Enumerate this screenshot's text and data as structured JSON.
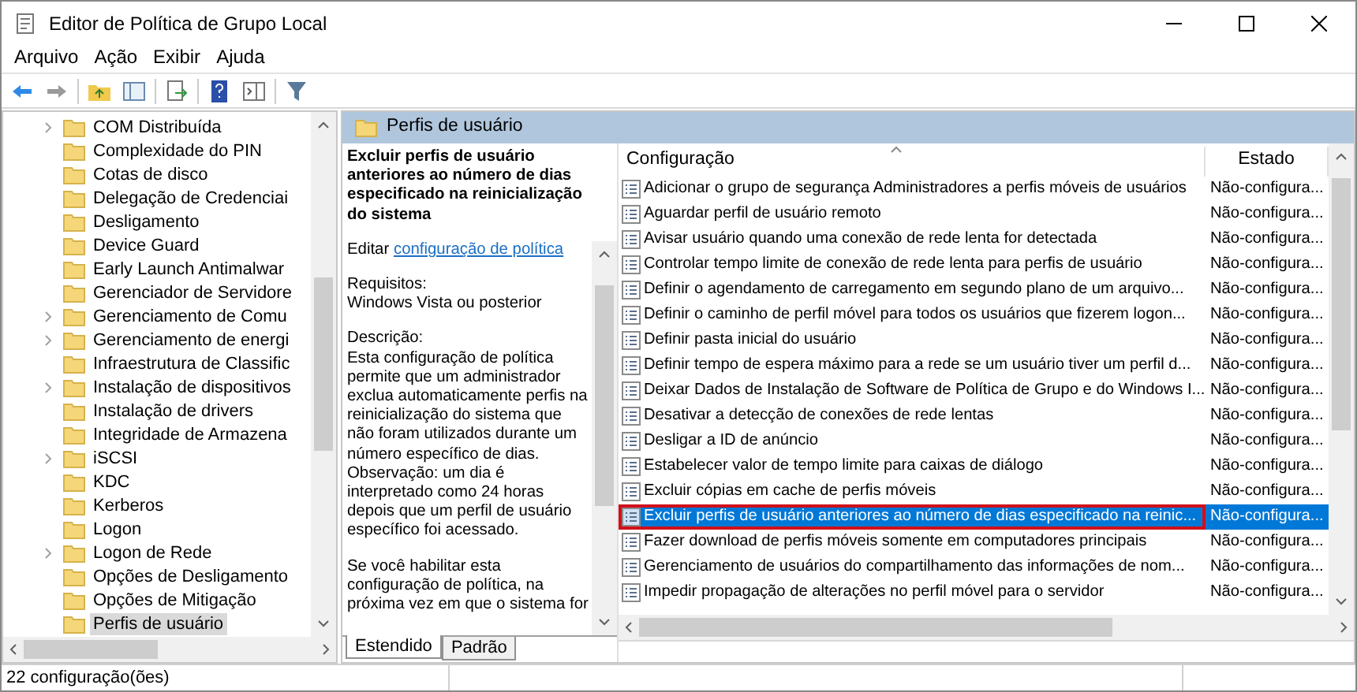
{
  "window": {
    "title": "Editor de Política de Grupo Local"
  },
  "menu": [
    "Arquivo",
    "Ação",
    "Exibir",
    "Ajuda"
  ],
  "tree": {
    "items": [
      {
        "label": "COM Distribuída",
        "has_children": true,
        "selected": false
      },
      {
        "label": "Complexidade do PIN",
        "has_children": false,
        "selected": false
      },
      {
        "label": "Cotas de disco",
        "has_children": false,
        "selected": false
      },
      {
        "label": "Delegação de Credenciai",
        "has_children": false,
        "selected": false
      },
      {
        "label": "Desligamento",
        "has_children": false,
        "selected": false
      },
      {
        "label": "Device Guard",
        "has_children": false,
        "selected": false
      },
      {
        "label": "Early Launch Antimalwar",
        "has_children": false,
        "selected": false
      },
      {
        "label": "Gerenciador de Servidore",
        "has_children": false,
        "selected": false
      },
      {
        "label": "Gerenciamento de Comu",
        "has_children": true,
        "selected": false
      },
      {
        "label": "Gerenciamento de energi",
        "has_children": true,
        "selected": false
      },
      {
        "label": "Infraestrutura de Classific",
        "has_children": false,
        "selected": false
      },
      {
        "label": "Instalação de dispositivos",
        "has_children": true,
        "selected": false
      },
      {
        "label": "Instalação de drivers",
        "has_children": false,
        "selected": false
      },
      {
        "label": "Integridade de Armazena",
        "has_children": false,
        "selected": false
      },
      {
        "label": "iSCSI",
        "has_children": true,
        "selected": false
      },
      {
        "label": "KDC",
        "has_children": false,
        "selected": false
      },
      {
        "label": "Kerberos",
        "has_children": false,
        "selected": false
      },
      {
        "label": "Logon",
        "has_children": false,
        "selected": false
      },
      {
        "label": "Logon de Rede",
        "has_children": true,
        "selected": false
      },
      {
        "label": "Opções de Desligamento",
        "has_children": false,
        "selected": false
      },
      {
        "label": "Opções de Mitigação",
        "has_children": false,
        "selected": false
      },
      {
        "label": "Perfis de usuário",
        "has_children": false,
        "selected": true
      }
    ]
  },
  "details": {
    "header": "Perfis de usuário",
    "title": "Excluir perfis de usuário anteriores ao número de dias especificado na reinicialização do sistema",
    "edit_prefix": "Editar",
    "edit_link": "configuração de política",
    "requirements_label": "Requisitos:",
    "requirements": "Windows Vista ou posterior",
    "description_label": "Descrição:",
    "description": "Esta configuração de política permite que um administrador exclua automaticamente perfis na reinicialização do sistema que não foram utilizados durante um número específico de dias. Observação: um dia é interpretado como 24 horas depois que um perfil de usuário específico foi acessado.",
    "more": "Se você habilitar esta configuração de política, na próxima vez em que o sistema for"
  },
  "tabs": [
    {
      "label": "Estendido",
      "selected": true
    },
    {
      "label": "Padrão",
      "selected": false
    }
  ],
  "list": {
    "columns": [
      "Configuração",
      "Estado"
    ],
    "rows": [
      {
        "name": "Adicionar o grupo de segurança Administradores a perfis móveis de usuários",
        "state": "Não-configura...",
        "selected": false,
        "outlined": false
      },
      {
        "name": "Aguardar perfil de usuário remoto",
        "state": "Não-configura...",
        "selected": false,
        "outlined": false
      },
      {
        "name": "Avisar usuário quando uma conexão de rede lenta for detectada",
        "state": "Não-configura...",
        "selected": false,
        "outlined": false
      },
      {
        "name": "Controlar tempo limite de conexão de rede lenta para perfis de usuário",
        "state": "Não-configura...",
        "selected": false,
        "outlined": false
      },
      {
        "name": "Definir o agendamento de carregamento em segundo plano de um arquivo...",
        "state": "Não-configura...",
        "selected": false,
        "outlined": false
      },
      {
        "name": "Definir o caminho de perfil móvel para todos os usuários que fizerem logon...",
        "state": "Não-configura...",
        "selected": false,
        "outlined": false
      },
      {
        "name": "Definir pasta inicial do usuário",
        "state": "Não-configura...",
        "selected": false,
        "outlined": false
      },
      {
        "name": "Definir tempo de espera máximo para a rede se um usuário tiver um perfil d...",
        "state": "Não-configura...",
        "selected": false,
        "outlined": false
      },
      {
        "name": "Deixar Dados de Instalação de Software de Política de Grupo e do Windows I...",
        "state": "Não-configura...",
        "selected": false,
        "outlined": false
      },
      {
        "name": "Desativar a detecção de conexões de rede lentas",
        "state": "Não-configura...",
        "selected": false,
        "outlined": false
      },
      {
        "name": "Desligar a ID de anúncio",
        "state": "Não-configura...",
        "selected": false,
        "outlined": false
      },
      {
        "name": "Estabelecer valor de tempo limite para caixas de diálogo",
        "state": "Não-configura...",
        "selected": false,
        "outlined": false
      },
      {
        "name": "Excluir cópias em cache de perfis móveis",
        "state": "Não-configura...",
        "selected": false,
        "outlined": false
      },
      {
        "name": "Excluir perfis de usuário anteriores ao número de dias especificado na reinic...",
        "state": "Não-configura...",
        "selected": true,
        "outlined": true
      },
      {
        "name": "Fazer download de perfis móveis somente em computadores principais",
        "state": "Não-configura...",
        "selected": false,
        "outlined": false
      },
      {
        "name": "Gerenciamento de usuários do compartilhamento das informações de nom...",
        "state": "Não-configura...",
        "selected": false,
        "outlined": false
      },
      {
        "name": "Impedir propagação de alterações no perfil móvel para o servidor",
        "state": "Não-configura...",
        "selected": false,
        "outlined": false
      }
    ]
  },
  "status_bar": "22 configuração(ões)"
}
